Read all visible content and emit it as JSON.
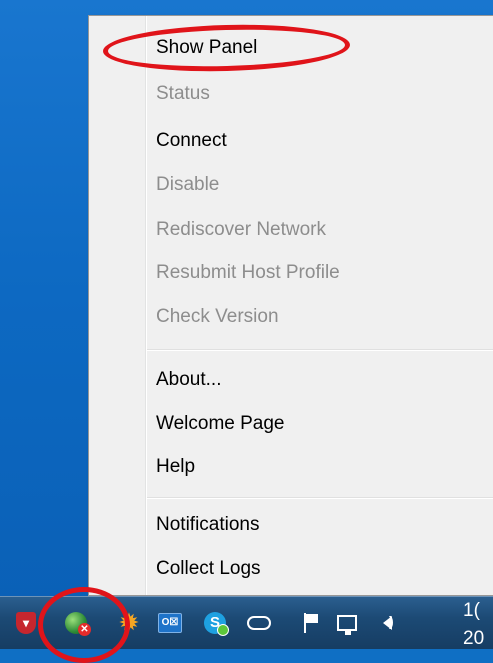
{
  "menu": {
    "items": [
      {
        "label": "Show Panel",
        "enabled": true
      },
      {
        "label": "Status",
        "enabled": false
      },
      {
        "label": "Connect",
        "enabled": true
      },
      {
        "label": "Disable",
        "enabled": false
      },
      {
        "label": "Rediscover Network",
        "enabled": false
      },
      {
        "label": "Resubmit Host Profile",
        "enabled": false
      },
      {
        "label": "Check Version",
        "enabled": false
      },
      {
        "label": "About...",
        "enabled": true
      },
      {
        "label": "Welcome Page",
        "enabled": true
      },
      {
        "label": "Help",
        "enabled": true
      },
      {
        "label": "Notifications",
        "enabled": true
      },
      {
        "label": "Collect Logs",
        "enabled": true
      }
    ]
  },
  "taskbar": {
    "tray_icons": [
      "shield-icon",
      "globe-error-icon",
      "sun-icon",
      "outlook-icon",
      "skype-icon",
      "cloud-icon",
      "flag-icon",
      "network-icon",
      "volume-icon"
    ],
    "outlook_text": "O☒",
    "skype_text": "S",
    "clock_time": "1(",
    "clock_date": "20"
  },
  "colors": {
    "annotation_red": "#e0141a",
    "disabled_text": "#8d8d8d",
    "menu_bg": "#f0f0f0"
  }
}
